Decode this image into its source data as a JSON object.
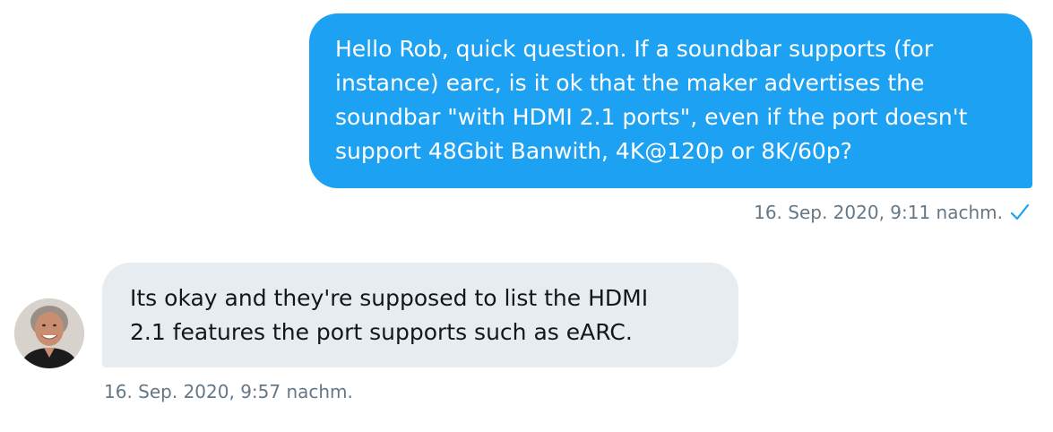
{
  "messages": {
    "outgoing": {
      "text": "Hello Rob, quick question. If a soundbar supports (for\ninstance) earc, is it ok that the maker advertises the\nsoundbar \"with HDMI 2.1 ports\", even if the port doesn't\nsupport 48Gbit Banwith, 4K@120p or 8K/60p?",
      "timestamp": "16. Sep. 2020, 9:11 nachm.",
      "status_icon": "check-icon"
    },
    "incoming": {
      "text": "Its okay and they're supposed to list the HDMI\n2.1 features the port supports such as eARC.",
      "timestamp": "16. Sep. 2020, 9:57 nachm.",
      "avatar_icon": "avatar"
    }
  },
  "colors": {
    "outgoing_bubble": "#1da1f2",
    "incoming_bubble": "#e6ecf0",
    "timestamp_text": "#657786"
  }
}
